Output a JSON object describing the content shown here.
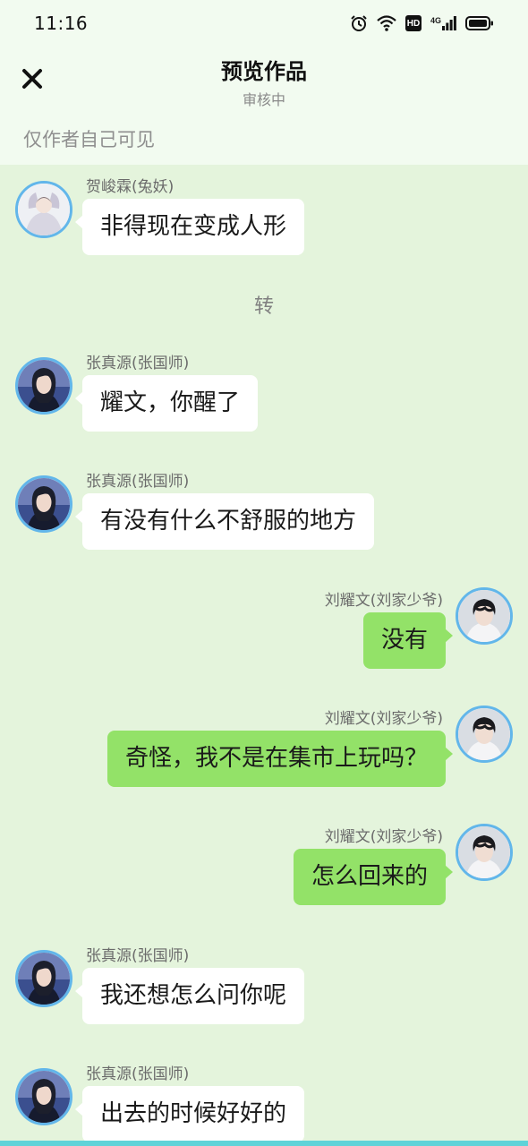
{
  "status_bar": {
    "time": "11:16",
    "network": "4G",
    "hd": "HD"
  },
  "header": {
    "title": "预览作品",
    "subtitle": "审核中",
    "visibility_note": "仅作者自己可见"
  },
  "messages": [
    {
      "side": "left",
      "name": "贺峻霖(兔妖)",
      "text": "非得现在变成人形",
      "avatar": "avatar-he"
    },
    {
      "side": "left",
      "name": "张真源(张国师)",
      "text": "耀文，你醒了",
      "avatar": "avatar-zhang"
    },
    {
      "side": "left",
      "name": "张真源(张国师)",
      "text": "有没有什么不舒服的地方",
      "avatar": "avatar-zhang"
    },
    {
      "side": "right",
      "name": "刘耀文(刘家少爷)",
      "text": "没有",
      "avatar": "avatar-liu"
    },
    {
      "side": "right",
      "name": "刘耀文(刘家少爷)",
      "text": "奇怪，我不是在集市上玩吗？",
      "avatar": "avatar-liu"
    },
    {
      "side": "right",
      "name": "刘耀文(刘家少爷)",
      "text": "怎么回来的",
      "avatar": "avatar-liu"
    },
    {
      "side": "left",
      "name": "张真源(张国师)",
      "text": "我还想怎么问你呢",
      "avatar": "avatar-zhang"
    },
    {
      "side": "left",
      "name": "张真源(张国师)",
      "text": "出去的时候好好的",
      "avatar": "avatar-zhang"
    }
  ],
  "separator": "转",
  "colors": {
    "background": "#e4f4dc",
    "header_bg": "#f2fbf0",
    "bubble_self": "#93e268",
    "bubble_other": "#ffffff",
    "avatar_ring": "#62b6ea"
  }
}
